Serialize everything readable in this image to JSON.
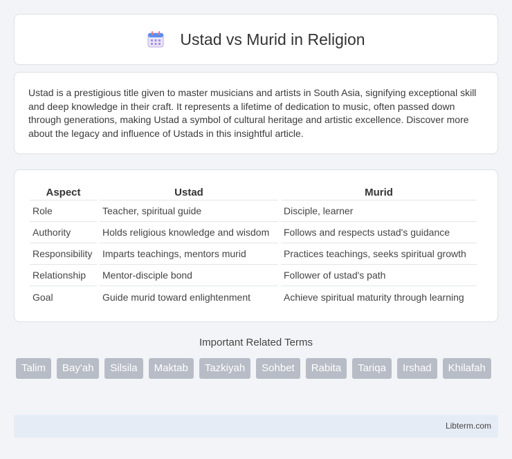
{
  "header": {
    "title": "Ustad vs Murid in Religion",
    "icon": "calendar-icon"
  },
  "description": "Ustad is a prestigious title given to master musicians and artists in South Asia, signifying exceptional skill and deep knowledge in their craft. It represents a lifetime of dedication to music, often passed down through generations, making Ustad a symbol of cultural heritage and artistic excellence. Discover more about the legacy and influence of Ustads in this insightful article.",
  "table": {
    "headers": [
      "Aspect",
      "Ustad",
      "Murid"
    ],
    "rows": [
      [
        "Role",
        "Teacher, spiritual guide",
        "Disciple, learner"
      ],
      [
        "Authority",
        "Holds religious knowledge and wisdom",
        "Follows and respects ustad's guidance"
      ],
      [
        "Responsibility",
        "Imparts teachings, mentors murid",
        "Practices teachings, seeks spiritual growth"
      ],
      [
        "Relationship",
        "Mentor-disciple bond",
        "Follower of ustad's path"
      ],
      [
        "Goal",
        "Guide murid toward enlightenment",
        "Achieve spiritual maturity through learning"
      ]
    ]
  },
  "related": {
    "title": "Important Related Terms",
    "tags": [
      "Talim",
      "Bay'ah",
      "Silsila",
      "Maktab",
      "Tazkiyah",
      "Sohbet",
      "Rabita",
      "Tariqa",
      "Irshad",
      "Khilafah"
    ]
  },
  "footer": {
    "site": "Libterm.com"
  }
}
